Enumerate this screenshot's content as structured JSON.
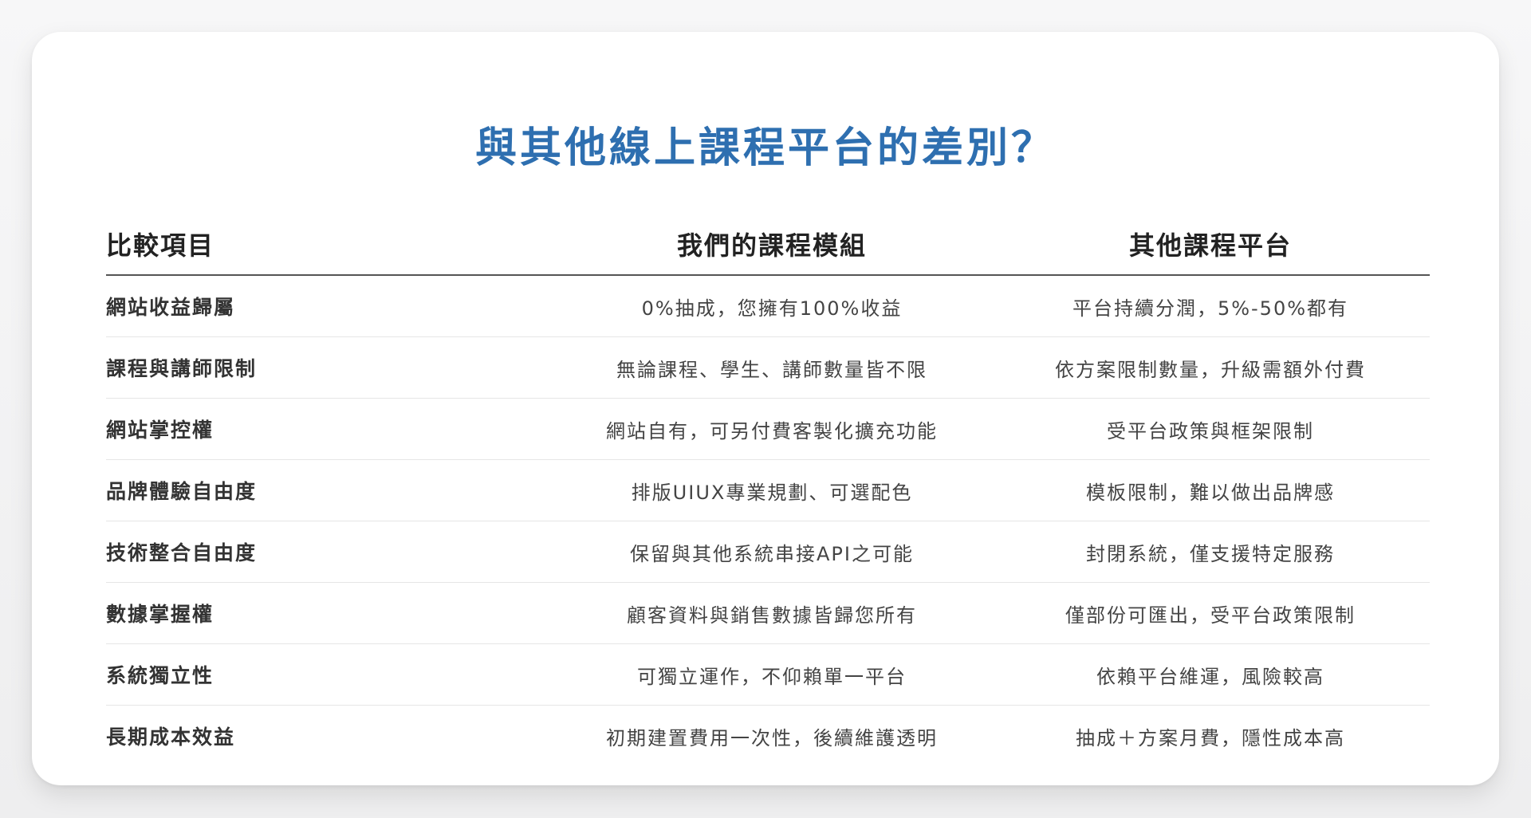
{
  "title": "與其他線上課程平台的差別？",
  "table": {
    "headers": [
      "比較項目",
      "我們的課程模組",
      "其他課程平台"
    ],
    "rows": [
      [
        "網站收益歸屬",
        "0%抽成，您擁有100%收益",
        "平台持續分潤，5%-50%都有"
      ],
      [
        "課程與講師限制",
        "無論課程、學生、講師數量皆不限",
        "依方案限制數量，升級需額外付費"
      ],
      [
        "網站掌控權",
        "網站自有，可另付費客製化擴充功能",
        "受平台政策與框架限制"
      ],
      [
        "品牌體驗自由度",
        "排版UIUX專業規劃、可選配色",
        "模板限制，難以做出品牌感"
      ],
      [
        "技術整合自由度",
        "保留與其他系統串接API之可能",
        "封閉系統，僅支援特定服務"
      ],
      [
        "數據掌握權",
        "顧客資料與銷售數據皆歸您所有",
        "僅部份可匯出，受平台政策限制"
      ],
      [
        "系統獨立性",
        "可獨立運作，不仰賴單一平台",
        "依賴平台維運，風險較高"
      ],
      [
        "長期成本效益",
        "初期建置費用一次性，後續維護透明",
        "抽成＋方案月費，隱性成本高"
      ]
    ]
  },
  "colors": {
    "title": "#2e6fb0",
    "header_rule": "#555555",
    "row_divider": "#e6e6e6"
  }
}
